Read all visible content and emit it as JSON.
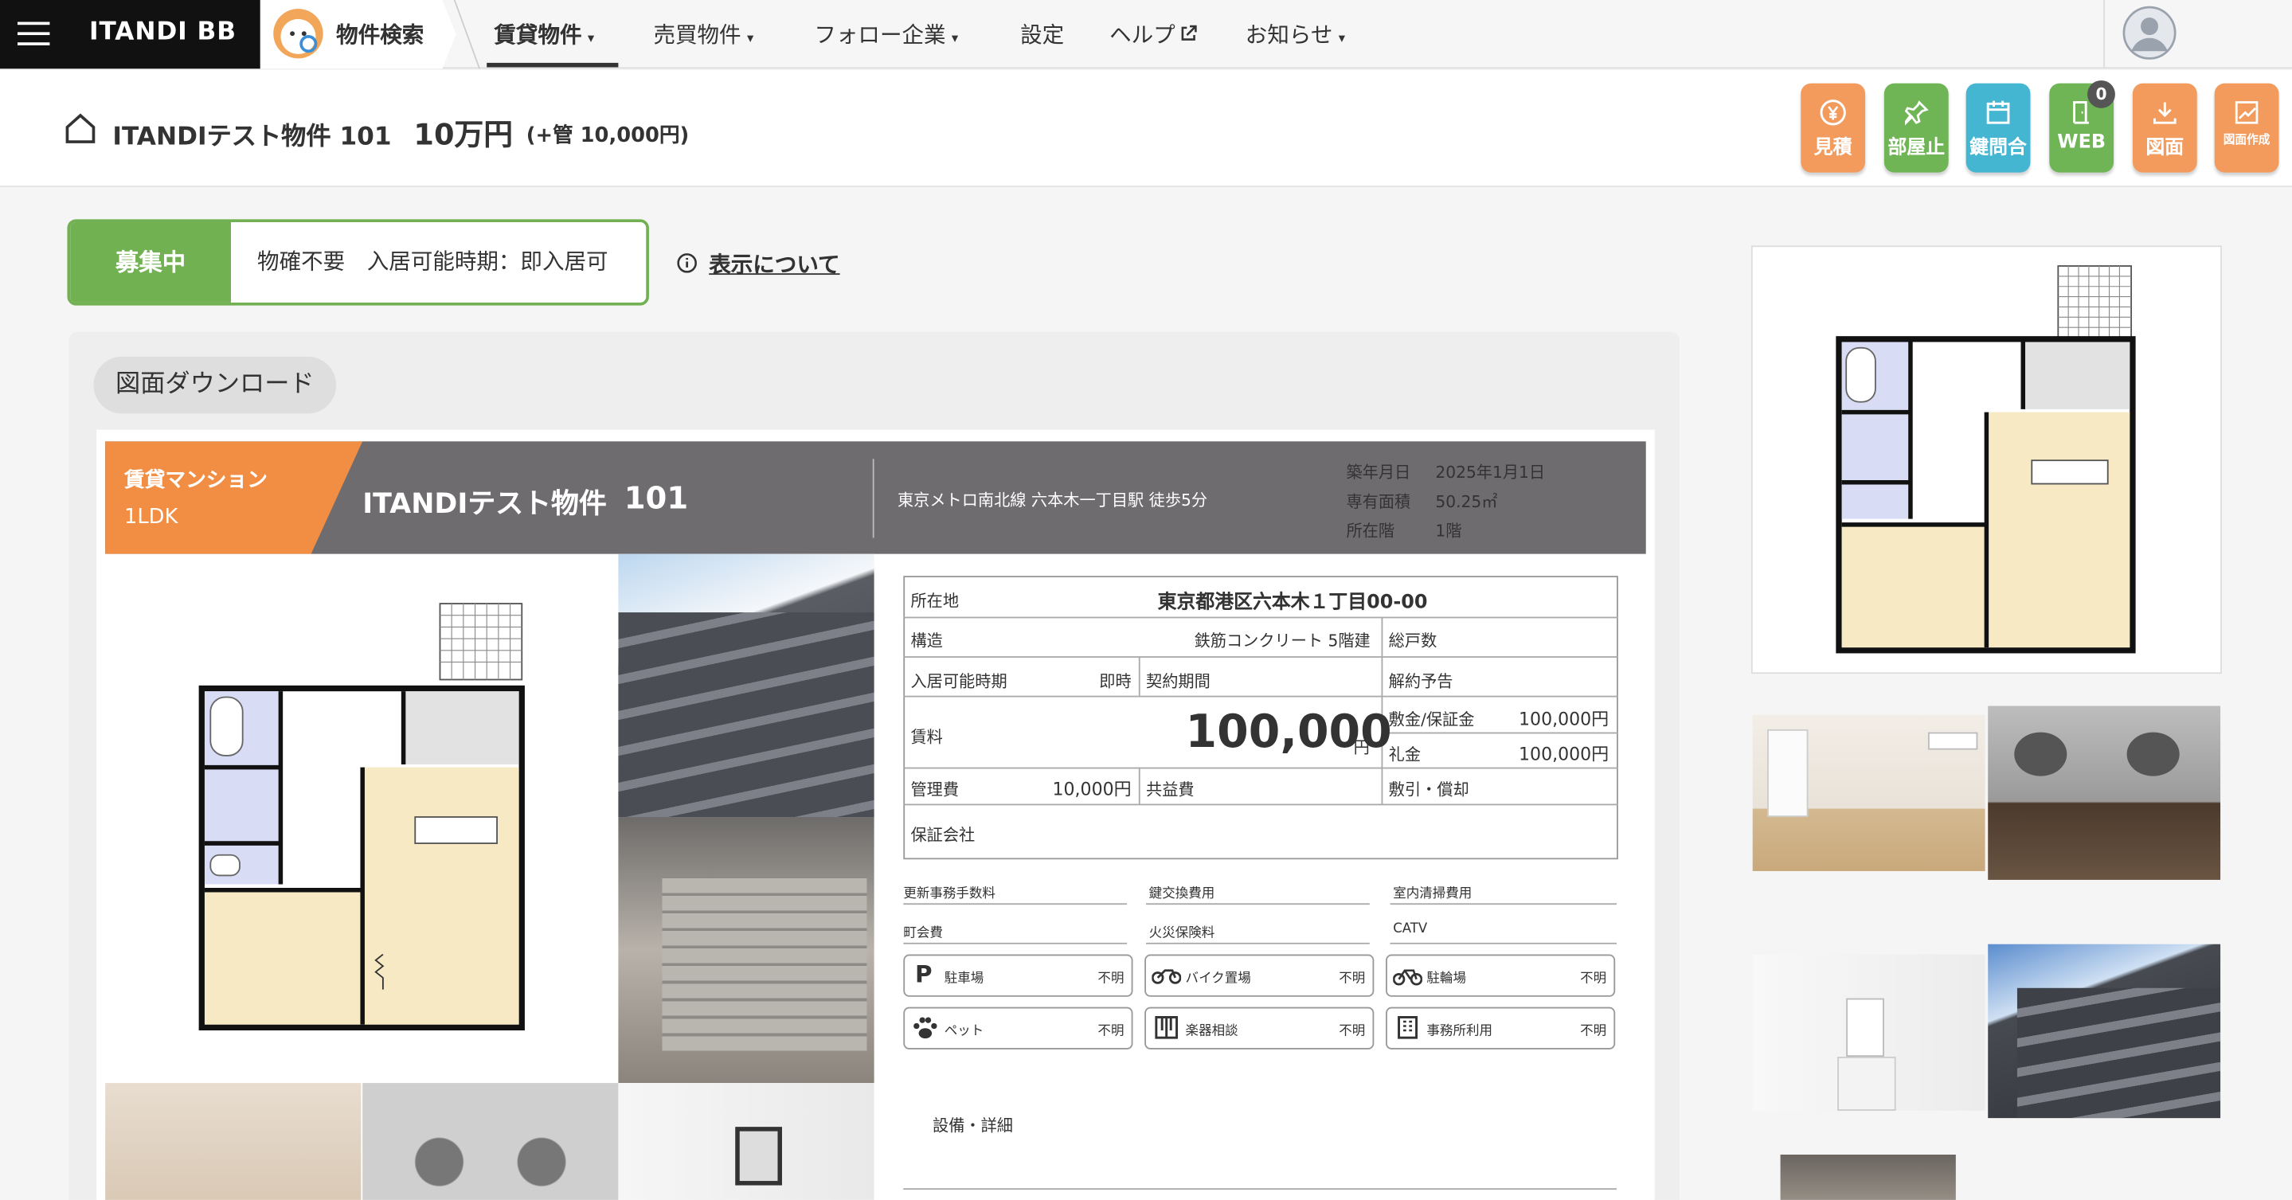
{
  "nav": {
    "brand": "ITANDI BB",
    "property_search": "物件検索",
    "items": [
      "賃貸物件",
      "売買物件",
      "フォロー企業",
      "設定",
      "ヘルプ",
      "お知らせ"
    ]
  },
  "header": {
    "property_name": "ITANDIテスト物件 101",
    "rent": "10万円",
    "fee": "(+管 10,000円)"
  },
  "actions": [
    {
      "label": "見積",
      "icon": "yen-icon",
      "color": "#f39b5c"
    },
    {
      "label": "部屋止",
      "icon": "pin-icon",
      "color": "#6fb556"
    },
    {
      "label": "鍵問合",
      "icon": "calendar-icon",
      "color": "#45b6d2"
    },
    {
      "label": "WEB",
      "icon": "door-icon",
      "color": "#6fb556",
      "badge": "0"
    },
    {
      "label": "図面",
      "icon": "download-icon",
      "color": "#f39b5c"
    },
    {
      "label": "図面作成",
      "icon": "chart-edit-icon",
      "color": "#f39b5c"
    }
  ],
  "status": {
    "label": "募集中",
    "text": "物確不要　入居可能時期：即入居可",
    "about": "表示について"
  },
  "download_label": "図面ダウンロード",
  "flyer": {
    "type": "賃貸マンション",
    "layout": "1LDK",
    "name": "ITANDIテスト物件",
    "room": "101",
    "station": "東京メトロ南北線 六本木一丁目駅 徒歩5分",
    "built_label": "築年月日",
    "built_value": "2025年1月1日",
    "area_label": "専有面積",
    "area_value": "50.25㎡",
    "floor_label": "所在階",
    "floor_value": "1階",
    "location_label": "所在地",
    "location_value": "東京都港区六本木１丁目00-00",
    "structure_label": "構造",
    "structure_value": "鉄筋コンクリート 5階建",
    "units_label": "総戸数",
    "movein_label": "入居可能時期",
    "movein_value": "即時",
    "contract_label": "契約期間",
    "notice_label": "解約予告",
    "rent_label": "賃料",
    "rent_value": "100,000",
    "rent_unit": "円",
    "deposit_label": "敷金/保証金",
    "deposit_value": "100,000円",
    "key_money_label": "礼金",
    "key_money_value": "100,000円",
    "mgmt_label": "管理費",
    "mgmt_value": "10,000円",
    "common_label": "共益費",
    "discount_label": "敷引・償却",
    "guarantor_label": "保証会社",
    "renewal_label": "更新事務手数料",
    "key_exchange_label": "鍵交換費用",
    "cleaning_label": "室内清掃費用",
    "town_fee_label": "町会費",
    "insurance_label": "火災保険料",
    "catv_label": "CATV",
    "amenities": [
      {
        "icon": "parking-icon",
        "label": "駐車場",
        "value": "不明"
      },
      {
        "icon": "motorbike-icon",
        "label": "バイク置場",
        "value": "不明"
      },
      {
        "icon": "bicycle-icon",
        "label": "駐輪場",
        "value": "不明"
      },
      {
        "icon": "paw-icon",
        "label": "ペット",
        "value": "不明"
      },
      {
        "icon": "piano-icon",
        "label": "楽器相談",
        "value": "不明"
      },
      {
        "icon": "building-icon",
        "label": "事務所利用",
        "value": "不明"
      }
    ],
    "equipment_label": "設備・詳細"
  }
}
